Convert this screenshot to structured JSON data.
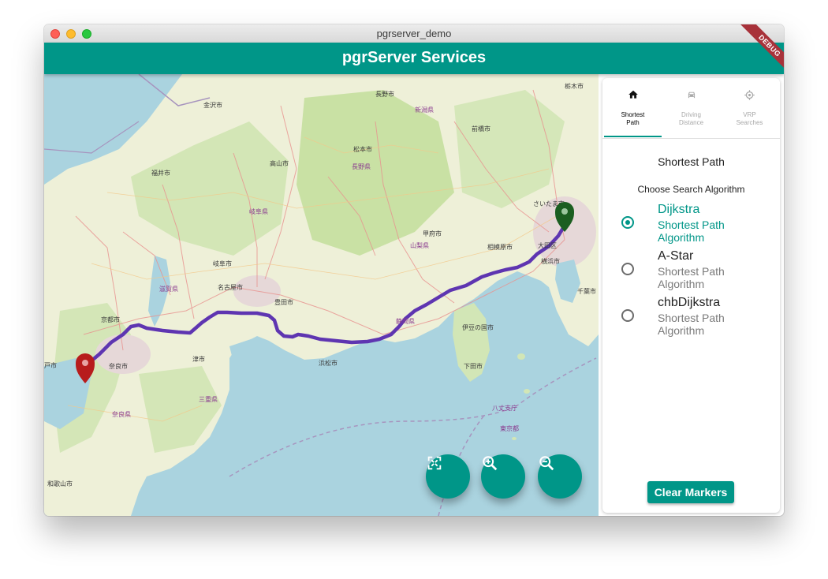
{
  "window": {
    "title": "pgrserver_demo"
  },
  "appbar": {
    "title": "pgrServer Services",
    "debug_banner": "DEBUG"
  },
  "tabs": [
    {
      "label_line1": "Shortest",
      "label_line2": "Path",
      "icon": "home-icon",
      "active": true
    },
    {
      "label_line1": "Driving",
      "label_line2": "Distance",
      "icon": "car-icon",
      "active": false
    },
    {
      "label_line1": "VRP",
      "label_line2": "Searches",
      "icon": "gps-icon",
      "active": false
    }
  ],
  "panel": {
    "title": "Shortest Path",
    "choose_label": "Choose Search Algorithm",
    "options": [
      {
        "name": "Dijkstra",
        "desc": "Shortest Path Algorithm",
        "selected": true
      },
      {
        "name": "A-Star",
        "desc": "Shortest Path Algorithm",
        "selected": false
      },
      {
        "name": "chbDijkstra",
        "desc": "Shortest Path Algorithm",
        "selected": false
      }
    ],
    "clear_button": "Clear Markers"
  },
  "map": {
    "labels": {
      "kanazawa": "金沢市",
      "fukui": "福井市",
      "gifu_pref": "岐阜県",
      "nagoya": "名古屋市",
      "gifu": "岐阜市",
      "kyoto": "京都市",
      "nara": "奈良市",
      "tsu": "津市",
      "toyota": "豊田市",
      "hamamatsu": "浜松市",
      "shizuoka_pref": "静岡県",
      "kofu": "甲府市",
      "yamanashi_pref": "山梨県",
      "nagano_pref": "長野県",
      "matsumoto": "松本市",
      "nagano": "長野市",
      "takayama": "高山市",
      "saitama": "さいたま市",
      "sagamihara": "相模原市",
      "ota": "大田区",
      "yokohama": "横浜市",
      "shiga_pref": "滋賀県",
      "wakayama": "和歌山市",
      "mie_pref": "三重県",
      "tokyo_pref": "東京都",
      "hachijo": "八丈支庁",
      "izu": "伊豆の国市",
      "shimoda": "下田市",
      "maebashi": "前橋市",
      "tochigi": "栃木市",
      "kobe": "戸市",
      "nara_pref": "奈良県",
      "tokyo_bay": "千葉市",
      "niigata": "新潟県"
    },
    "marker_colors": {
      "start": "#b71c1c",
      "end": "#1b5e20",
      "route": "#5e35b1"
    },
    "fab_icons": [
      "fullscreen-icon",
      "zoom-in-icon",
      "zoom-out-icon"
    ]
  }
}
